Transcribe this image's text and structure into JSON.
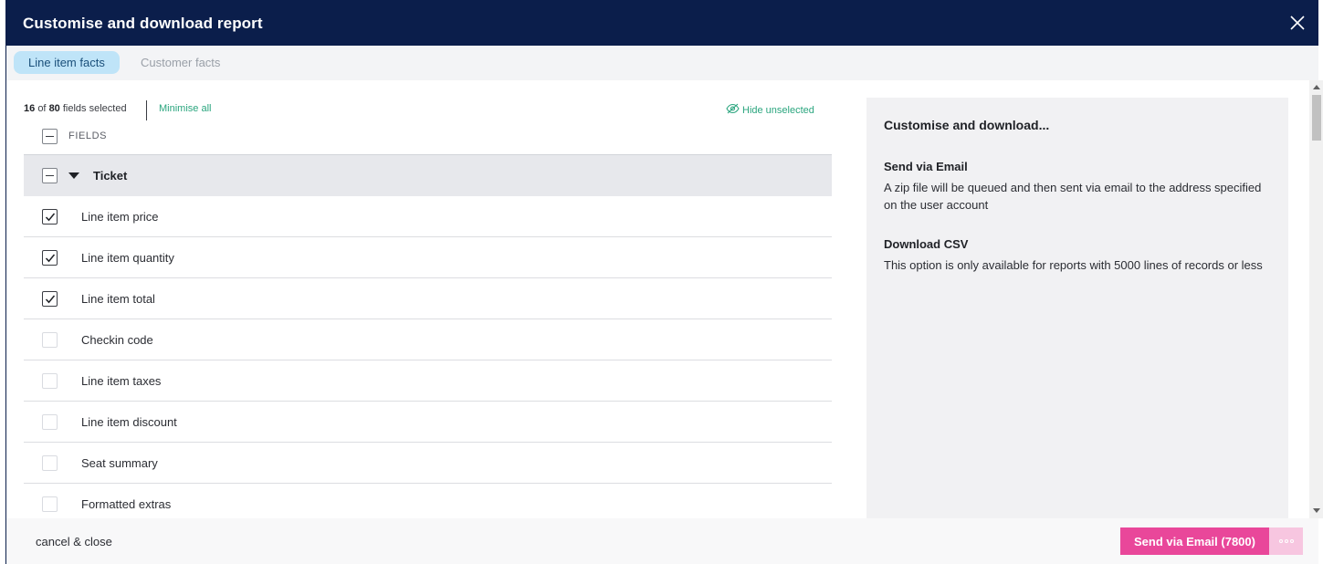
{
  "header": {
    "title": "Customise and download report",
    "close_icon": "close-icon"
  },
  "tabs": [
    {
      "label": "Line item facts",
      "active": true
    },
    {
      "label": "Customer facts",
      "active": false
    }
  ],
  "toolbar": {
    "selected_count": "16",
    "count_of": "of",
    "total_count": "80",
    "count_suffix": "fields selected",
    "minimise_label": "Minimise all",
    "hide_unselected_label": "Hide unselected",
    "hide_icon": "eye-off-icon"
  },
  "fields_header": {
    "label": "FIELDS"
  },
  "group": {
    "name": "Ticket",
    "state": "partial",
    "caret_icon": "caret-down-icon"
  },
  "fields": [
    {
      "label": "Line item price",
      "checked": true
    },
    {
      "label": "Line item quantity",
      "checked": true
    },
    {
      "label": "Line item total",
      "checked": true
    },
    {
      "label": "Checkin code",
      "checked": false
    },
    {
      "label": "Line item taxes",
      "checked": false
    },
    {
      "label": "Line item discount",
      "checked": false
    },
    {
      "label": "Seat summary",
      "checked": false
    },
    {
      "label": "Formatted extras",
      "checked": false
    }
  ],
  "side_panel": {
    "title": "Customise and download...",
    "options": [
      {
        "name": "Send via Email",
        "description": "A zip file will be queued and then sent via email to the address specified on the user account"
      },
      {
        "name": "Download CSV",
        "description": "This option is only available for reports with 5000 lines of records or less"
      }
    ]
  },
  "footer": {
    "cancel_label": "cancel & close",
    "send_label": "Send via Email (7800)",
    "more_icon": "more-options-icon"
  },
  "colors": {
    "header_bg": "#0b1e4b",
    "accent_green": "#2aa57e",
    "primary_pink": "#e9479a",
    "tab_active_bg": "#bfe4f8"
  }
}
